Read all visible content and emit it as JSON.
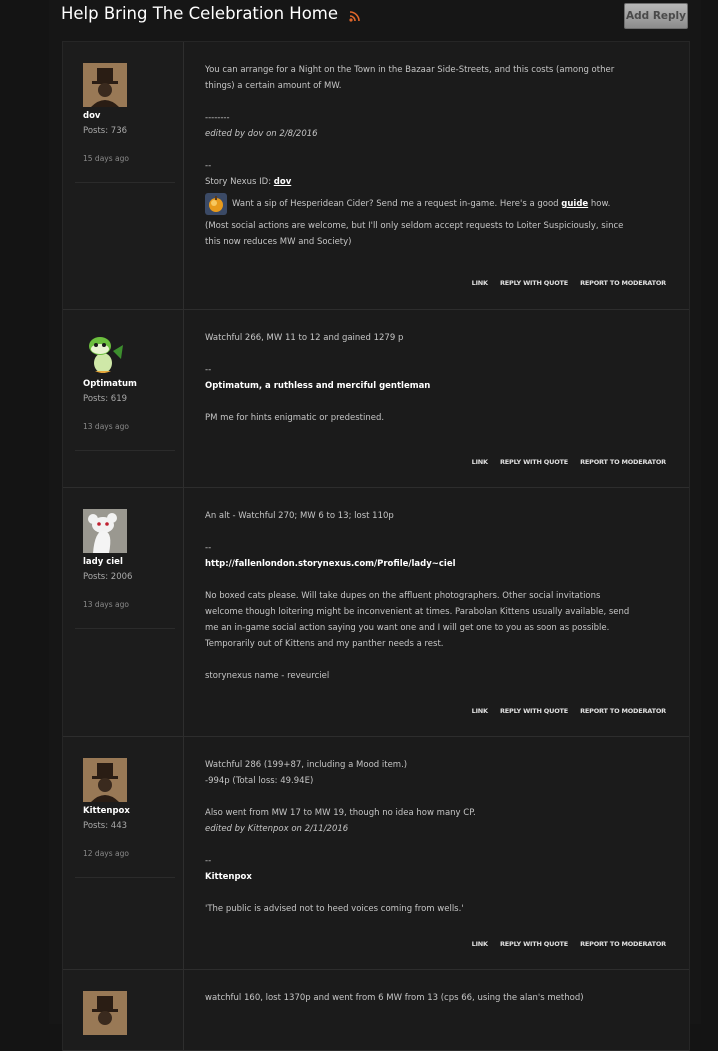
{
  "thread": {
    "title": "Help Bring The Celebration Home",
    "add_reply_label": "Add Reply"
  },
  "actions": {
    "link": "LINK",
    "reply_quote": "REPLY WITH QUOTE",
    "report": "REPORT TO MODERATOR"
  },
  "posts": [
    {
      "author": "dov",
      "posts_label": "Posts:",
      "post_count": "736",
      "age": "15 days ago",
      "lines": {
        "l1": "You can arrange for a Night on the Town in the Bazaar Side-Streets, and this costs (among other",
        "l2": "things) a certain amount of MW.",
        "dashes": "--------",
        "edited": "edited by dov on 2/8/2016",
        "sigdash": "--",
        "sn_prefix": "Story Nexus ID: ",
        "sn_link": "dov",
        "cider_text": "Want a sip of Hesperidean Cider? Send me a request in-game. Here's a good ",
        "guide_link": "guide",
        "cider_after": " how.",
        "note1": "(Most social actions are welcome, but I'll only seldom accept requests to Loiter Suspiciously, since",
        "note2": "this now reduces MW and Society)"
      }
    },
    {
      "author": "Optimatum",
      "posts_label": "Posts:",
      "post_count": "619",
      "age": "13 days ago",
      "lines": {
        "l1": "Watchful 266, MW 11 to 12 and gained 1279 p",
        "sigdash": "--",
        "sig": "Optimatum, a ruthless and merciful gentleman",
        "pm": "PM me for hints enigmatic or predestined."
      }
    },
    {
      "author": "lady ciel",
      "posts_label": "Posts:",
      "post_count": "2006",
      "age": "13 days ago",
      "lines": {
        "l1": "An alt - Watchful 270; MW 6 to 13; lost 110p",
        "sigdash": "--",
        "url": "http://fallenlondon.storynexus.com/Profile/lady~ciel",
        "p1": "No boxed cats please. Will take dupes on the affluent photographers. Other social invitations",
        "p2": "welcome though loitering might be inconvenient at times. Parabolan Kittens usually available, send",
        "p3": "me an in-game social action saying you want one and I will get one to you as soon as possible.",
        "p4": "Temporarily out of Kittens and my panther needs a rest.",
        "sn": "storynexus name - reveurciel"
      }
    },
    {
      "author": "Kittenpox",
      "posts_label": "Posts:",
      "post_count": "443",
      "age": "12 days ago",
      "lines": {
        "l1": "Watchful 286 (199+87, including a Mood item.)",
        "l2": "-994p (Total loss: 49.94E)",
        "l3": "Also went from MW 17 to MW 19, though no idea how many CP.",
        "edited": "edited by Kittenpox on 2/11/2016",
        "sigdash": "--",
        "sig": "Kittenpox",
        "quote": "'The public is advised not to heed voices coming from wells.'"
      }
    },
    {
      "lines": {
        "l1": "watchful 160, lost 1370p and went from 6 MW from 13 (cps 66, using the alan's method)"
      }
    }
  ],
  "colors": {
    "background": "#141414",
    "post_bg": "#1b1b1b",
    "button_bg": "#a6a6a6",
    "rss_orange": "#e0662a"
  }
}
